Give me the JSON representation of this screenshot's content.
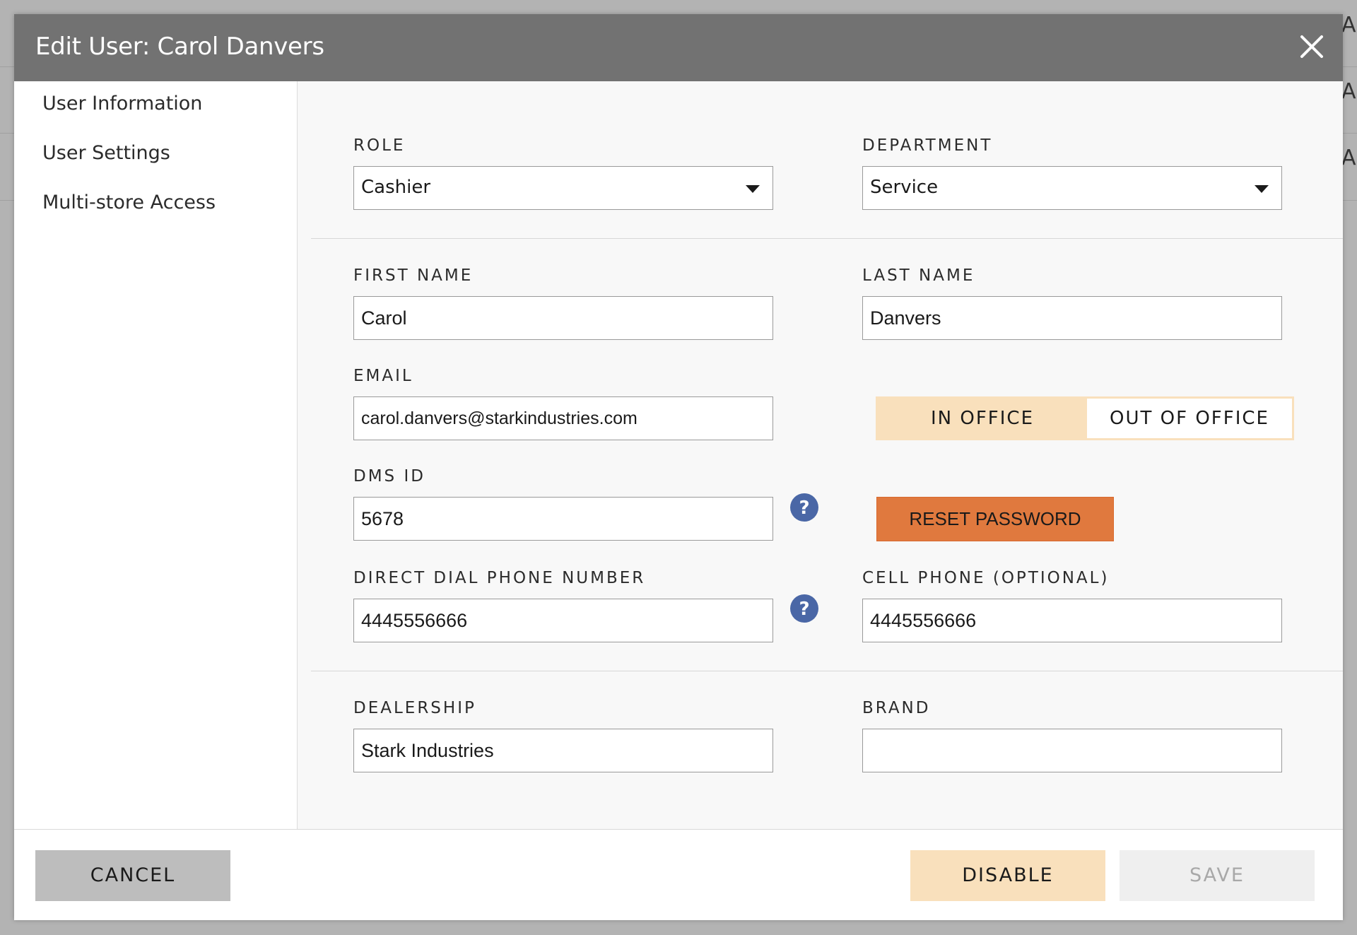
{
  "background": {
    "right_letters": [
      "A",
      "A",
      "A"
    ]
  },
  "modal": {
    "title": "Edit User: Carol Danvers",
    "close_icon": "close-icon"
  },
  "sidebar": {
    "items": [
      {
        "label": "User Information"
      },
      {
        "label": "User Settings"
      },
      {
        "label": "Multi-store Access"
      }
    ]
  },
  "form": {
    "role": {
      "label": "ROLE",
      "value": "Cashier"
    },
    "department": {
      "label": "DEPARTMENT",
      "value": "Service"
    },
    "first_name": {
      "label": "FIRST NAME",
      "value": "Carol"
    },
    "last_name": {
      "label": "LAST NAME",
      "value": "Danvers"
    },
    "email": {
      "label": "EMAIL",
      "value": "carol.danvers@starkindustries.com"
    },
    "office_toggle": {
      "options": [
        "IN OFFICE",
        "OUT OF OFFICE"
      ],
      "selected": "IN OFFICE"
    },
    "dms_id": {
      "label": "DMS ID",
      "value": "5678"
    },
    "reset_password_label": "RESET PASSWORD",
    "direct_dial": {
      "label": "DIRECT DIAL PHONE NUMBER",
      "value": "4445556666"
    },
    "cell_phone": {
      "label": "CELL PHONE (OPTIONAL)",
      "value": "4445556666"
    },
    "dealership": {
      "label": "DEALERSHIP",
      "value": "Stark Industries"
    },
    "brand": {
      "label": "BRAND",
      "value": ""
    }
  },
  "footer": {
    "cancel_label": "CANCEL",
    "disable_label": "DISABLE",
    "save_label": "SAVE"
  },
  "colors": {
    "header_bg": "#727272",
    "accent_orange": "#e0793e",
    "toggle_active": "#f9e0bc",
    "help_icon_blue": "#4a67a6"
  }
}
